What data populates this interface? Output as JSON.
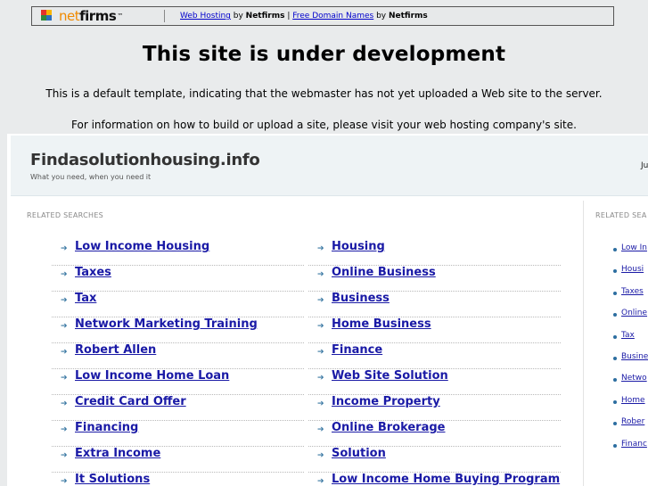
{
  "topbar": {
    "brand": "netfirms",
    "link1": "Web Hosting",
    "by1": " by ",
    "brand1": "Netfirms",
    "sep": " | ",
    "link2": "Free Domain Names",
    "by2": " by ",
    "brand2": "Netfirms"
  },
  "headline": "This site is under development",
  "info_line1": "This is a default template, indicating that the webmaster has not yet uploaded a Web site to the server.",
  "info_line2": "For information on how to build or upload a site, please visit your web hosting company's site.",
  "parked": {
    "site_title": "Findasolutionhousing.info",
    "tagline": "What you need, when you need it",
    "date_fragment": "Ju",
    "related_label": "RELATED SEARCHES",
    "left_column": [
      "Low Income Housing",
      "Taxes",
      "Tax",
      "Network Marketing Training",
      "Robert Allen",
      "Low Income Home Loan",
      "Credit Card Offer",
      "Financing",
      "Extra Income",
      "It Solutions"
    ],
    "right_column": [
      "Housing",
      "Online Business",
      "Business",
      "Home Business",
      "Finance",
      "Web Site Solution",
      "Income Property",
      "Online Brokerage",
      "Solution",
      "Low Income Home Buying Program"
    ],
    "side_label": "RELATED SEA",
    "side_items": [
      "Low In",
      "Housi",
      "Taxes",
      "Online",
      "Tax",
      "Busine",
      "Netwo",
      "Home",
      "Rober",
      "Financ"
    ]
  },
  "colors": {
    "link": "#1a1aa6",
    "arrow": "#3a78a3",
    "brand_orange": "#f08a00"
  }
}
